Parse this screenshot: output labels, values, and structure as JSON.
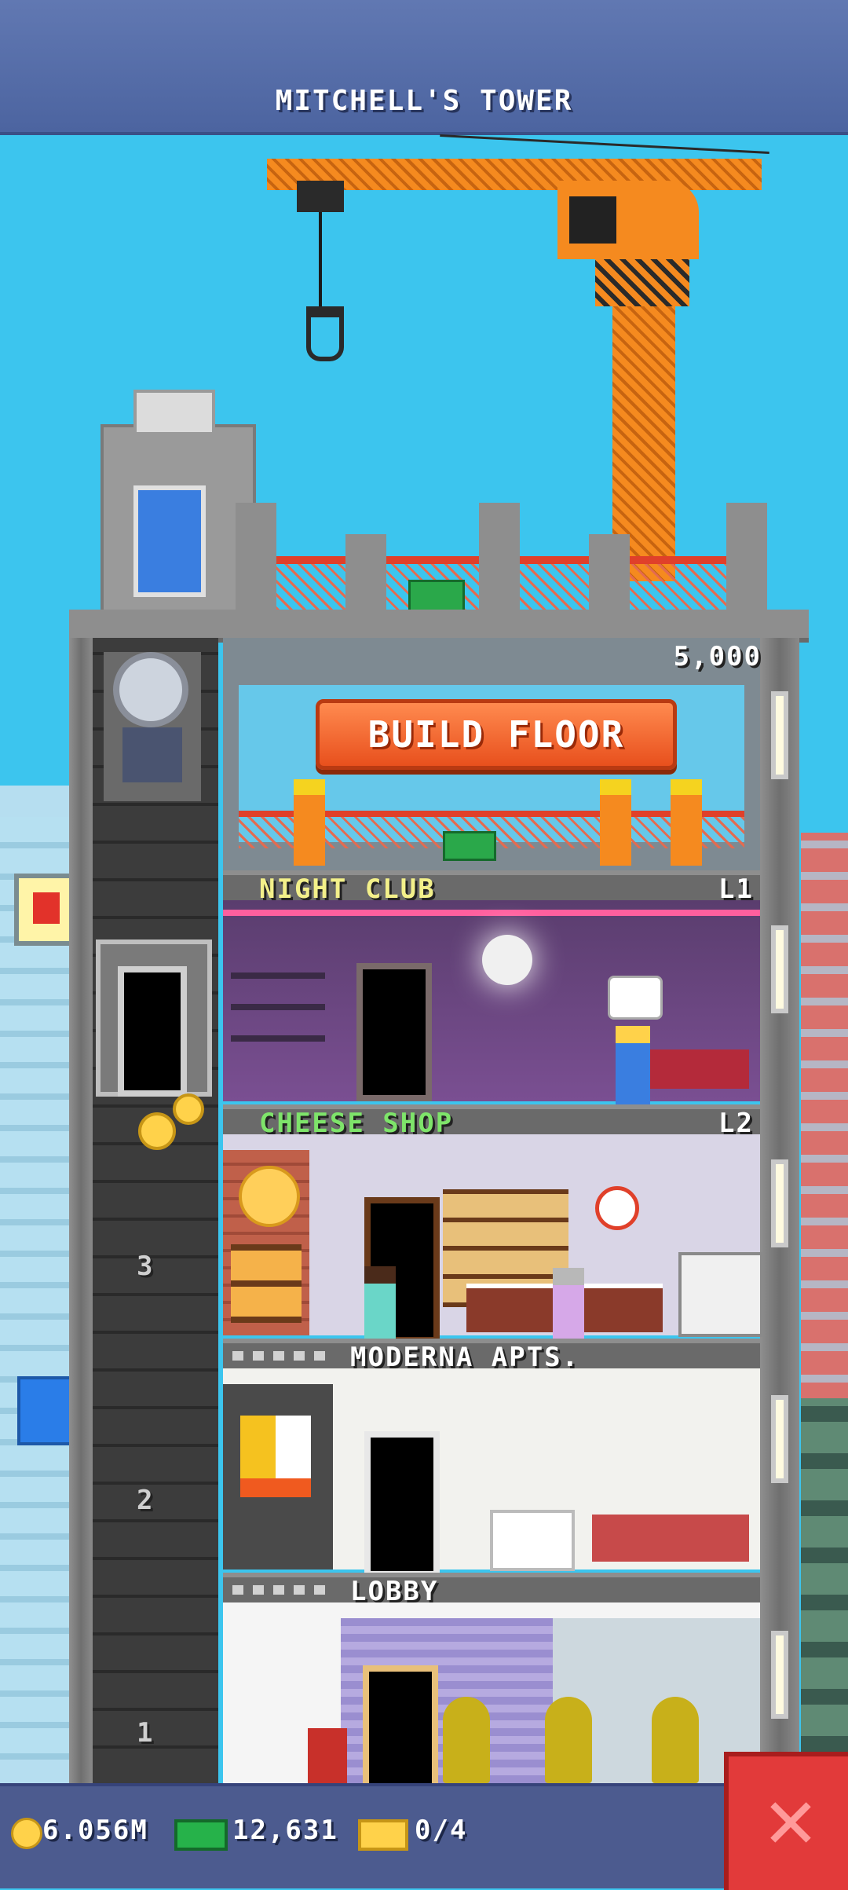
{
  "header": {
    "title": "MITCHELL'S TOWER"
  },
  "build_floor": {
    "label": "BUILD FLOOR",
    "cost": "5,000"
  },
  "floors": [
    {
      "name": "NIGHT CLUB",
      "level": "L1",
      "color": "#f3f08a"
    },
    {
      "name": "CHEESE SHOP",
      "level": "L2",
      "color": "#7ee46a"
    },
    {
      "name": "MODERNA APTS.",
      "level": "",
      "color": "#ffffff"
    },
    {
      "name": "LOBBY",
      "level": "",
      "color": "#ffffff"
    }
  ],
  "elevator": {
    "floor_numbers": [
      "3",
      "2",
      "1"
    ]
  },
  "bottom_bar": {
    "coins": "6.056M",
    "bux": "12,631",
    "tickets": "0/4"
  },
  "icons": {
    "coin": "coin-icon",
    "bux": "bux-banknote-icon",
    "ticket": "golden-ticket-icon",
    "close": "close-x-icon"
  },
  "colors": {
    "sky": "#3cc5ee",
    "header": "#5a70ad",
    "crane": "#f58a1f",
    "build_button": "#f0642a",
    "close_button": "#e23a3a"
  }
}
